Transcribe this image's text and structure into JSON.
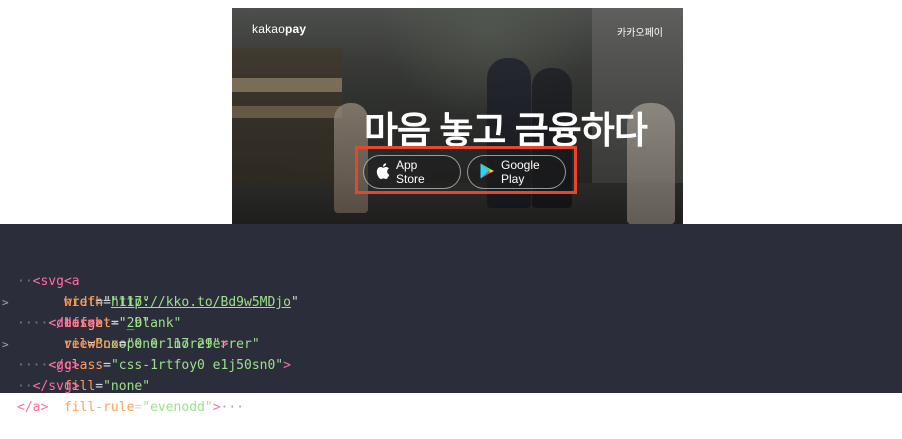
{
  "hero": {
    "logo_prefix": "kakao",
    "logo_suffix": "pay",
    "top_right_label": "카카오페이",
    "headline": "마음 놓고 금융하다",
    "buttons": {
      "app_store": "App Store",
      "google_play": "Google Play"
    },
    "highlight_color": "#e5472c"
  },
  "code": {
    "line1": {
      "open": "<",
      "tag": "a",
      "attr_href": "href",
      "href": "http://kko.to/Bd9w5MDjo",
      "attr_target": "target",
      "target": "\"_blank\"",
      "attr_rel": "rel",
      "rel": "\"noopener noreferrer\"",
      "attr_class": "class",
      "class": "\"css-1rtfoy0 e1j50sn0\"",
      "close": ">"
    },
    "line2": {
      "tag": "svg",
      "attr_width": "width",
      "width": "\"117\"",
      "attr_height": "height",
      "height": "\"29\"",
      "attr_viewbox": "viewBox",
      "viewbox": "\"0 0 117 29\""
    },
    "line3": {
      "tag": "defs",
      "ellipsis": "···"
    },
    "line4": {
      "tag": "/defs"
    },
    "line5": {
      "tag": "g",
      "attr_fill": "fill",
      "fill": "\"none\"",
      "attr_fill_rule": "fill-rule",
      "fill_rule": "\"evenodd\"",
      "ellipsis": "···"
    },
    "line6": {
      "tag": "/g"
    },
    "line7": {
      "tag": "/svg"
    },
    "line8": {
      "tag": "/a"
    },
    "colors": {
      "background": "#2b2d3a",
      "tag": "#ff6ea3",
      "attribute": "#ff9f5a",
      "value": "#9be28a"
    }
  }
}
